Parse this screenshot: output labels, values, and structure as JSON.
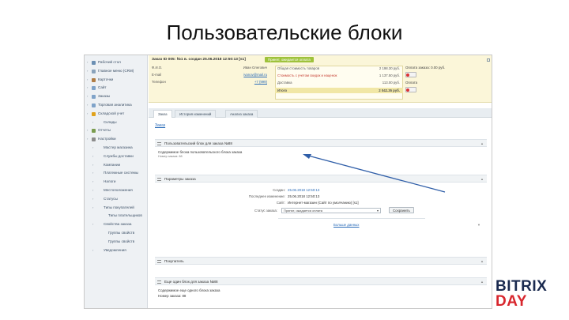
{
  "slide": {
    "title": "Пользовательские блоки"
  },
  "sidebar": {
    "items": [
      {
        "label": "Рабочий стол",
        "icon": "desktop-icon",
        "color": "#6b8fb3",
        "level": 0
      },
      {
        "label": "Главное меню (CRM)",
        "icon": "menu-icon",
        "color": "#8aa3bb",
        "level": 0
      },
      {
        "label": "Карточки",
        "icon": "cards-icon",
        "color": "#b07d45",
        "level": 0
      },
      {
        "label": "Сайт",
        "icon": "site-icon",
        "color": "#7fa3c9",
        "level": 0
      },
      {
        "label": "Заказы",
        "icon": "orders-icon",
        "color": "#7fa3c9",
        "level": 0
      },
      {
        "label": "Торговая аналитика",
        "icon": "analytics-icon",
        "color": "#7fa3c9",
        "level": 0
      },
      {
        "label": "Складской учет",
        "icon": "warehouse-icon",
        "color": "#e0a21b",
        "level": 0
      },
      {
        "label": "Склады",
        "icon": "",
        "color": "",
        "level": 1
      },
      {
        "label": "Отчеты",
        "icon": "reports-icon",
        "color": "#7a9c4f",
        "level": 0
      },
      {
        "label": "Настройки",
        "icon": "settings-icon",
        "color": "#8c8c8c",
        "level": 0
      },
      {
        "label": "Мастер магазина",
        "icon": "",
        "color": "",
        "level": 1
      },
      {
        "label": "Службы доставки",
        "icon": "",
        "color": "",
        "level": 1
      },
      {
        "label": "Компании",
        "icon": "",
        "color": "",
        "level": 1
      },
      {
        "label": "Платежные системы",
        "icon": "",
        "color": "",
        "level": 1
      },
      {
        "label": "Налоги",
        "icon": "",
        "color": "",
        "level": 1
      },
      {
        "label": "Местоположения",
        "icon": "",
        "color": "",
        "level": 1
      },
      {
        "label": "Статусы",
        "icon": "",
        "color": "",
        "level": 1
      },
      {
        "label": "Типы покупателей",
        "icon": "",
        "color": "",
        "level": 1
      },
      {
        "label": "Типы плательщиков",
        "icon": "",
        "color": "",
        "level": 2
      },
      {
        "label": "Свойства заказа",
        "icon": "",
        "color": "",
        "level": 1
      },
      {
        "label": "Группы свойств",
        "icon": "",
        "color": "",
        "level": 2
      },
      {
        "label": "Группы свойств",
        "icon": "",
        "color": "",
        "level": 2
      },
      {
        "label": "Уведомления",
        "icon": "",
        "color": "",
        "level": 1
      }
    ]
  },
  "order": {
    "title": "Заказ ID 005: №1 в. создан 25.06.2018 12:50:13 [s1]",
    "status_badge": "Принят, ожидается оплата",
    "customer": [
      {
        "label": "Ф.И.О.",
        "value": "Иван Олегович"
      },
      {
        "label": "E-mail",
        "value": "ivanov@mail.ru"
      },
      {
        "label": "Телефон",
        "value": "+7 (999)"
      }
    ],
    "totals": [
      {
        "label": "Общая стоимость товаров",
        "value": "2 198.30 руб."
      },
      {
        "label": "Стоимость с учетом скидок и наценок",
        "value": "1 137.50 руб."
      },
      {
        "label": "Доставка",
        "value": "113.00 руб."
      },
      {
        "label": "Итого",
        "value": "2 042.35 руб."
      }
    ],
    "payment_status": "Оплата заказа: 0.00 руб.",
    "payment_label": "Оплата",
    "accent": "#9ec23b"
  },
  "tabs": [
    {
      "label": "Заказ",
      "active": true
    },
    {
      "label": "История изменений",
      "active": false
    },
    {
      "label": "Анализ заказа",
      "active": false
    }
  ],
  "section": {
    "title": "Заказ"
  },
  "custom_block": {
    "title": "Пользовательский блок для заказа №88",
    "line1": "Содержимое блока пользовательского блока заказа",
    "line2": "Номер заказа: 88"
  },
  "params": {
    "title": "Параметры заказа",
    "fields": [
      {
        "label": "Создан:",
        "value": "25.06.2018 12:50:13"
      },
      {
        "label": "Последнее изменение:",
        "value": "25.06.2018 12:50:13"
      },
      {
        "label": "Сайт:",
        "value": "Интернет-магазин (Сайт по умолчанию) [s1]"
      }
    ],
    "status_label": "Статус заказа:",
    "status_value": "Принят, ожидается оплата",
    "save_button": "Сохранить",
    "more_link": "Больше данных"
  },
  "buyer": {
    "title": "Покупатель"
  },
  "extra_block": {
    "title": "Еще один блок для заказа №88",
    "line1": "Содержимое еще одного блока заказа",
    "line2": "Номер заказа: 88"
  },
  "logo": {
    "line1": "BITRIX",
    "line2": "DAY",
    "color1": "#1a2a4f",
    "color2": "#d8262d"
  }
}
